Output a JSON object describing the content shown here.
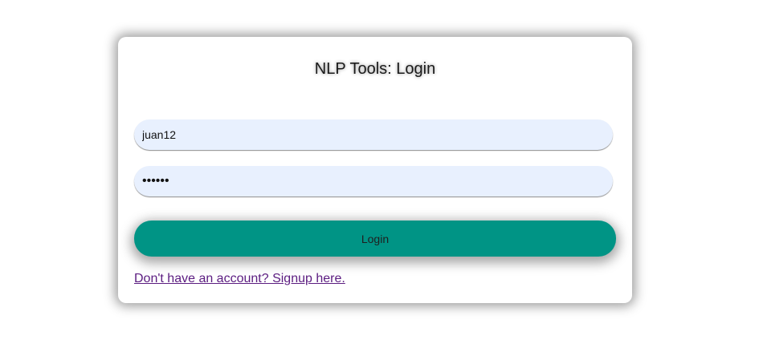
{
  "login_card": {
    "title": "NLP Tools: Login",
    "username_value": "juan12",
    "password_value": "••••••",
    "login_label": "Login",
    "signup_link_text": "Don't have an account? Signup here."
  },
  "colors": {
    "button": "#009485",
    "input_bg": "#e8f0fe",
    "link": "#5b1c80"
  }
}
